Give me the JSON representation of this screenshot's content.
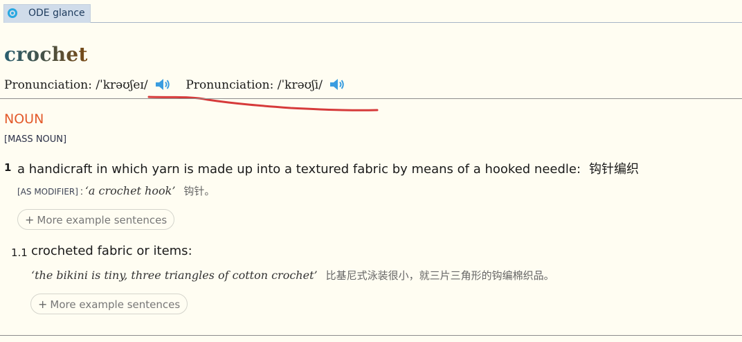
{
  "tab": {
    "label": "ODE glance",
    "icon": "target-icon"
  },
  "entry": {
    "headword": "crochet",
    "pronunciations": [
      {
        "label": "Pronunciation:",
        "ipa": "/ˈkrəʊʃeɪ/",
        "icon": "speaker-icon"
      },
      {
        "label": "Pronunciation:",
        "ipa": "/ˈkrəʊʃi/",
        "icon": "speaker-icon"
      }
    ],
    "part_of_speech": "NOUN",
    "grammar": "[MASS NOUN]",
    "senses": [
      {
        "number": "1",
        "definition": "a handicraft in which yarn is made up into a textured fabric by means of a hooked needle:",
        "translation": "钩针编织",
        "modifier": "[AS MODIFIER]",
        "colon": ":",
        "example": "‘a crochet hook’",
        "example_translation": "钩针。",
        "more_label": "More example sentences"
      }
    ],
    "subsenses": [
      {
        "number": "1.1",
        "definition": "crocheted fabric or items:",
        "example": "‘the bikini is tiny, three triangles of cotton crochet’",
        "example_translation": "比基尼式泳装很小，就三片三角形的钩编棉织品。",
        "more_label": "More example sentences"
      }
    ]
  },
  "colors": {
    "background": "#fffdf2",
    "pos": "#e35a2b",
    "speaker": "#3a9de0",
    "annotation": "#d63a3a"
  }
}
